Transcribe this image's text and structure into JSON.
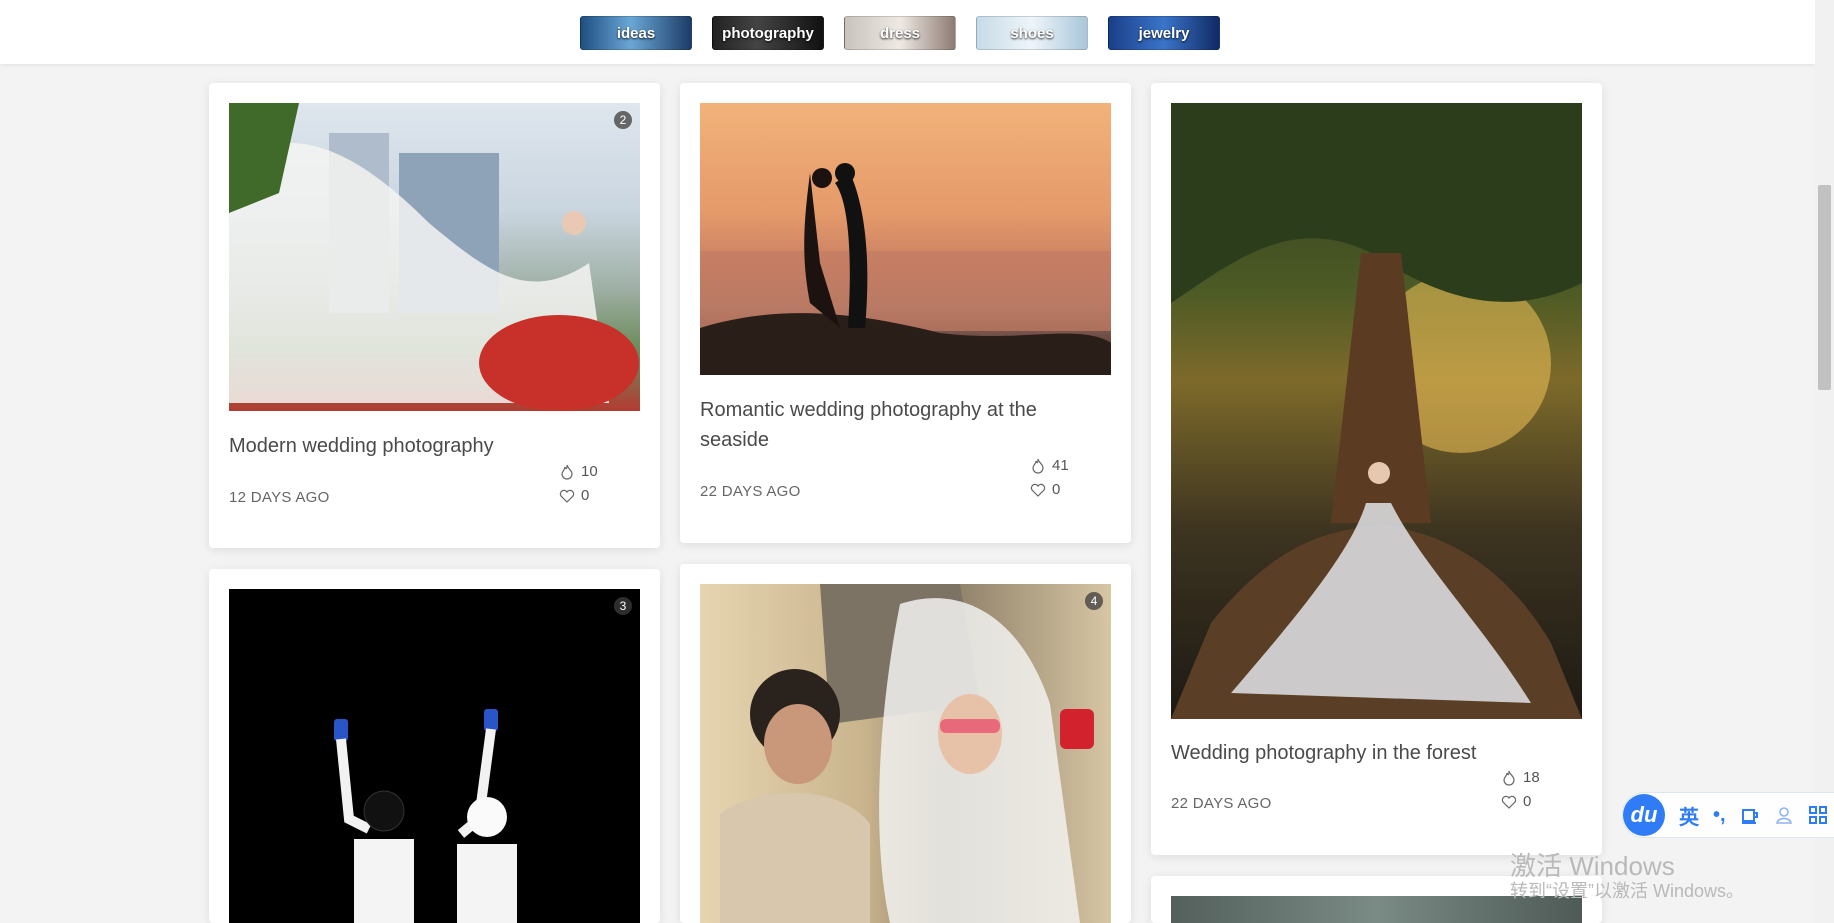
{
  "categories": [
    {
      "label": "ideas"
    },
    {
      "label": "photography"
    },
    {
      "label": "dress"
    },
    {
      "label": "shoes"
    },
    {
      "label": "jewelry"
    }
  ],
  "cards": [
    {
      "title": "Modern wedding photography",
      "date": "12 DAYS AGO",
      "views": "10",
      "likes": "0",
      "badge": "2"
    },
    {
      "title": "Romantic wedding photography at the seaside",
      "date": "22 DAYS AGO",
      "views": "41",
      "likes": "0"
    },
    {
      "title": "Wedding photography in the forest",
      "date": "22 DAYS AGO",
      "views": "18",
      "likes": "0"
    },
    {
      "badge": "3"
    },
    {
      "badge": "4"
    }
  ],
  "ime": {
    "logo": "du",
    "lang": "英",
    "punct": "•,"
  },
  "watermark": {
    "line1": "激活 Windows",
    "line2": "转到“设置”以激活 Windows。"
  }
}
